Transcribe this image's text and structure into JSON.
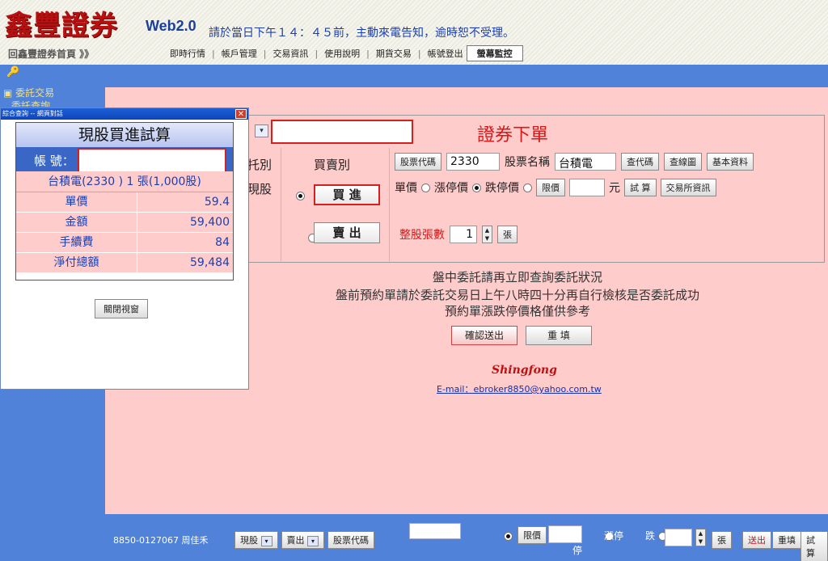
{
  "header": {
    "logo": "鑫豐證券",
    "web_badge": "Web2.0",
    "notice": "請於當日下午１４：４５前，主動來電告知，逾時恕不受理。",
    "home_link": "回鑫豐證券首頁 》》"
  },
  "nav": {
    "items": [
      "即時行情",
      "帳戶管理",
      "交易資訊",
      "使用說明",
      "期貨交易",
      "帳號登出"
    ],
    "active": "螢幕監控"
  },
  "sidebar": {
    "item1": "委託交易",
    "item2": "委託查詢"
  },
  "order": {
    "title": "證券下單",
    "col1_title": "托別",
    "col1_value": "現股",
    "col2_title": "買賣別",
    "buy_label": "買 進",
    "sell_label": "賣 出",
    "stock_code_btn": "股票代碼",
    "stock_code_value": "2330",
    "stock_name_label": "股票名稱",
    "stock_name_value": "台積電",
    "lookup_btn": "查代碼",
    "chart_btn": "查線圖",
    "basic_btn": "基本資料",
    "price_label": "單價",
    "limit_up_label": "漲停價",
    "limit_down_label": "跌停價",
    "limit_price_btn": "限價",
    "yuan": "元",
    "trial_btn": "試 算",
    "exchange_btn": "交易所資訊",
    "lots_label": "整股張數",
    "lots_value": "1",
    "lots_unit_btn": "張"
  },
  "notes": {
    "line1": "盤中委託請再立即查詢委託狀況",
    "line2": "盤前預約單請於委託交易日上午八時四十分再自行檢核是否委託成功",
    "line3": "預約單漲跌停價格僅供參考"
  },
  "actions": {
    "confirm": "確認送出",
    "reset": "重 填"
  },
  "footer": {
    "company": "Shingfong",
    "email": "E-mail：ebroker8850@yahoo.com.tw"
  },
  "popup": {
    "window_title": "綜合查詢 -- 網頁對話",
    "heading": "現股買進試算",
    "account_label": "帳 號：",
    "stock_line": "台積電(2330 ) 1 張(1,000股)",
    "rows": [
      {
        "label": "單價",
        "value": "59.4"
      },
      {
        "label": "金額",
        "value": "59,400"
      },
      {
        "label": "手續費",
        "value": "84"
      },
      {
        "label": "淨付總額",
        "value": "59,484"
      }
    ],
    "close_btn": "關閉視窗"
  },
  "bottombar": {
    "account": "8850-0127067 周佳禾",
    "type": "現股",
    "side": "賣出",
    "stock_code_btn": "股票代碼",
    "limit_btn": "限價",
    "limit_up": "漲停",
    "limit_down": "跌",
    "limit_down_2": "停",
    "unit_btn": "張",
    "send_btn": "送出",
    "reset_btn": "重填",
    "trial_btn": "試算"
  },
  "colors": {
    "brand_red": "#b81010",
    "sidebar_blue": "#4f82d8",
    "panel_pink": "#ffcccc"
  }
}
